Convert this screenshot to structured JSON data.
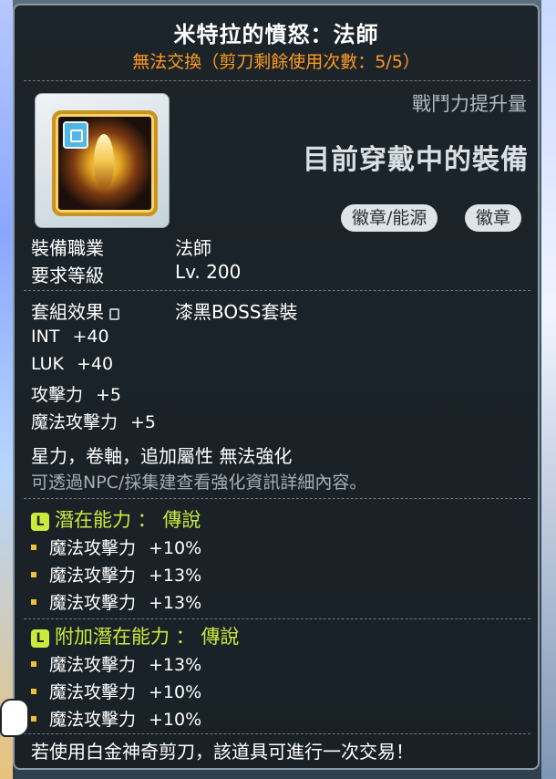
{
  "item": {
    "title": "米特拉的憤怒：法師",
    "trade_notice": "無法交換（剪刀剩餘使用次數：5/5）",
    "power_label": "戰鬥力提升量",
    "equipped_label": "目前穿戴中的裝備",
    "tags": [
      "徽章/能源",
      "徽章"
    ]
  },
  "requirements": [
    {
      "key": "裝備職業",
      "value": "法師"
    },
    {
      "key": "要求等級",
      "value": "Lv. 200"
    }
  ],
  "set": {
    "key": "套組效果",
    "value": "漆黑BOSS套裝"
  },
  "stats": [
    {
      "name": "INT",
      "value": "+40"
    },
    {
      "name": "LUK",
      "value": "+40"
    },
    {
      "name": "攻擊力",
      "value": "+5"
    },
    {
      "name": "魔法攻擊力",
      "value": "+5"
    }
  ],
  "enhance_notice": "星力，卷軸，追加屬性 無法強化",
  "enhance_hint": "可透過NPC/採集建查看強化資訊詳細內容。",
  "potential": {
    "badge": "L",
    "title": "潛在能力 ： 傳說",
    "lines": [
      {
        "name": "魔法攻擊力",
        "value": "+10%"
      },
      {
        "name": "魔法攻擊力",
        "value": "+13%"
      },
      {
        "name": "魔法攻擊力",
        "value": "+13%"
      }
    ]
  },
  "additional_potential": {
    "badge": "L",
    "title": "附加潛在能力 ： 傳說",
    "lines": [
      {
        "name": "魔法攻擊力",
        "value": "+13%"
      },
      {
        "name": "魔法攻擊力",
        "value": "+10%"
      },
      {
        "name": "魔法攻擊力",
        "value": "+10%"
      }
    ]
  },
  "footer": "若使用白金神奇剪刀，該道具可進行一次交易！",
  "colors": {
    "trade_notice": "#ff9b1f",
    "potential": "#cbea3d",
    "bullet": "#f0c233"
  }
}
